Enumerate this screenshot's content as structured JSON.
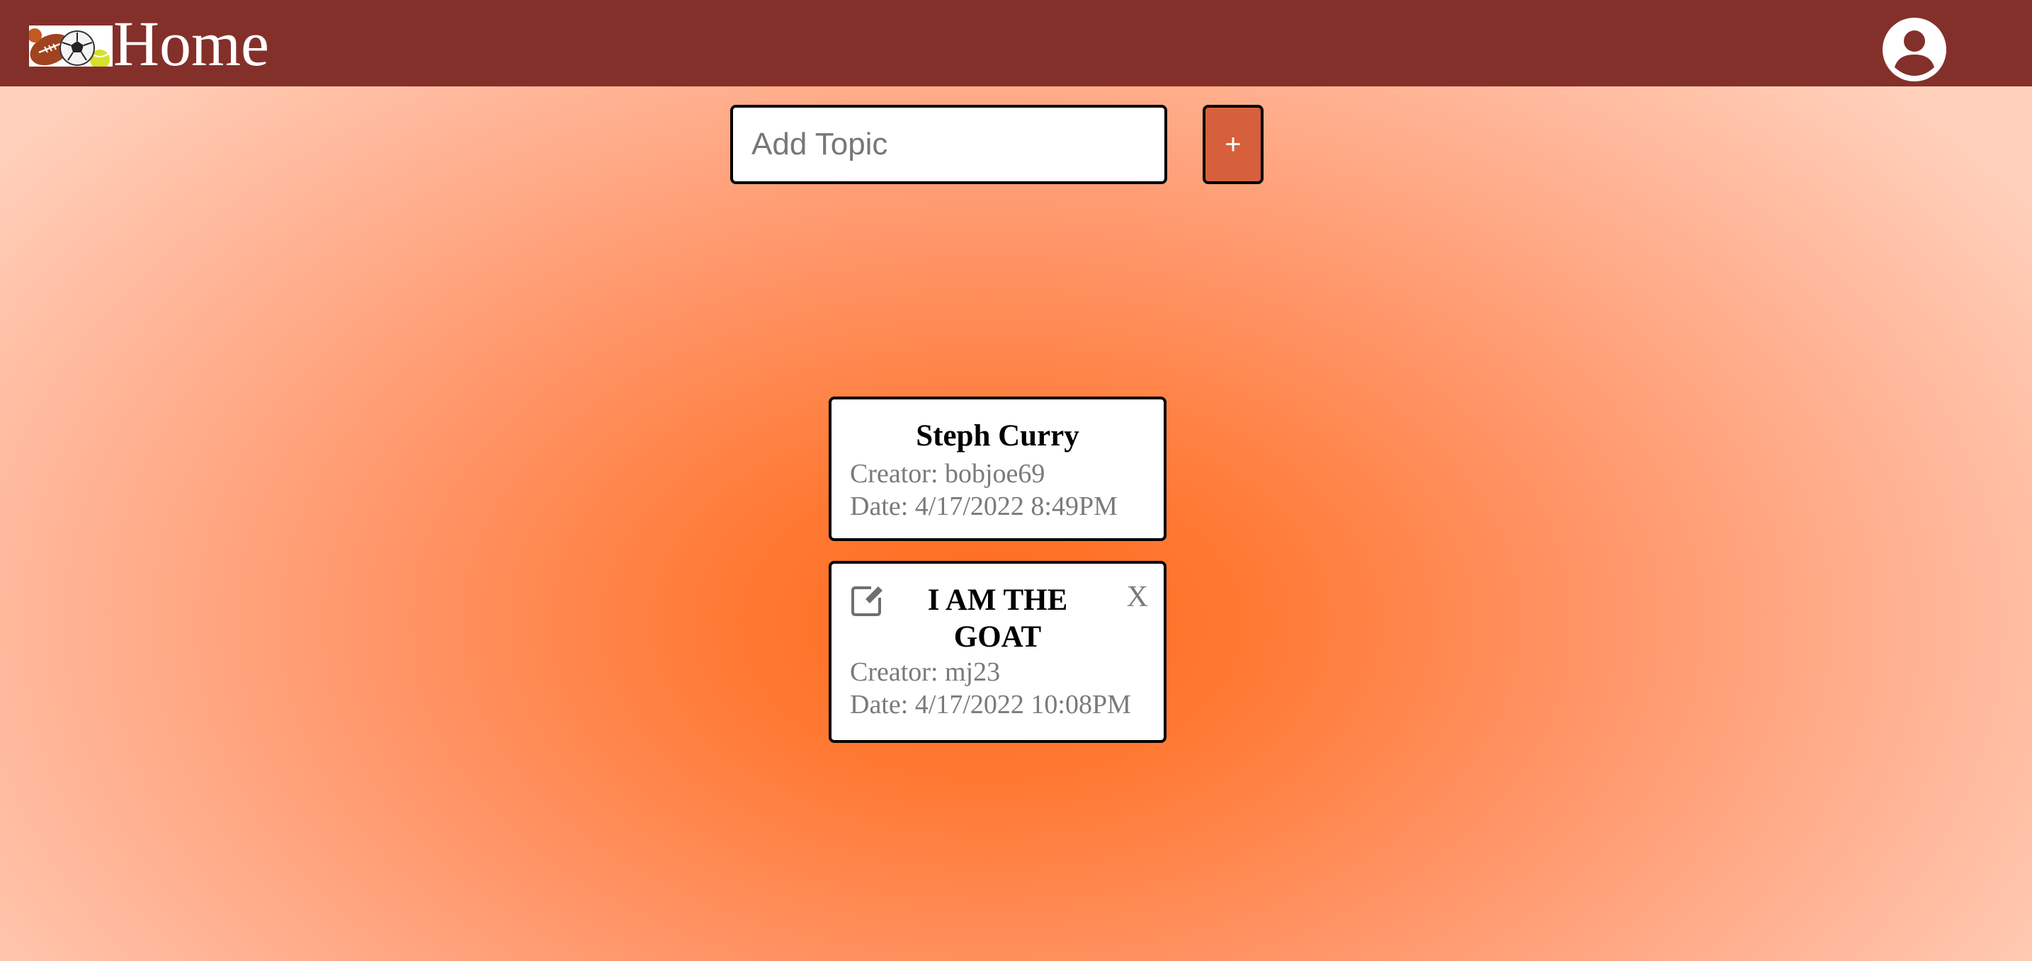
{
  "header": {
    "logo_icon": "sports-balls-logo-icon",
    "title": "Home",
    "profile_icon": "account-circle-icon"
  },
  "add_topic": {
    "placeholder": "Add Topic",
    "value": "",
    "add_label": "+"
  },
  "topics": [
    {
      "title": "Steph Curry",
      "creator": "Creator: bobjoe69",
      "date": "Date: 4/17/2022 8:49PM",
      "editable": false
    },
    {
      "title": "I AM THE GOAT",
      "creator": "Creator: mj23",
      "date": "Date: 4/17/2022 10:08PM",
      "editable": true,
      "edit_icon": "edit-square-icon",
      "delete_label": "X"
    }
  ],
  "colors": {
    "header_bg": "#84302a",
    "add_button_bg": "#d6603b",
    "background_center": "#ff6a1a",
    "background_edge": "#ffd0bb",
    "meta_text": "#7a7a7a"
  }
}
